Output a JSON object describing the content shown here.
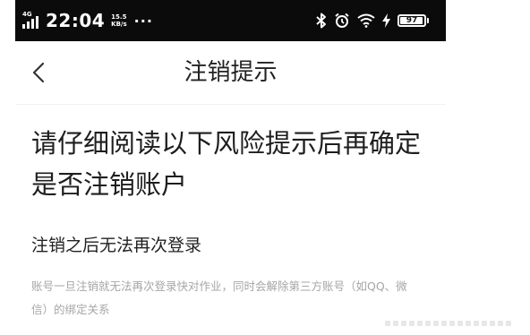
{
  "status_bar": {
    "network": "4G",
    "time": "22:04",
    "net_speed_value": "15.5",
    "net_speed_unit": "KB/s",
    "more": "···",
    "battery_level": "97",
    "icons": [
      "signal-icon",
      "bluetooth-icon",
      "alarm-icon",
      "wifi-icon",
      "charging-icon",
      "battery-icon"
    ]
  },
  "nav": {
    "back_icon": "chevron-left-icon",
    "title": "注销提示"
  },
  "content": {
    "heading": "请仔细阅读以下风险提示后再确定是否注销账户",
    "section_title": "注销之后无法再次登录",
    "section_body": "账号一旦注销就无法再次登录快对作业，同时会解除第三方账号（如QQ、微信）的绑定关系"
  },
  "colors": {
    "status_bar_bg": "#0b0b0b",
    "title_text": "#222222",
    "body_text": "#a6a6a6"
  }
}
